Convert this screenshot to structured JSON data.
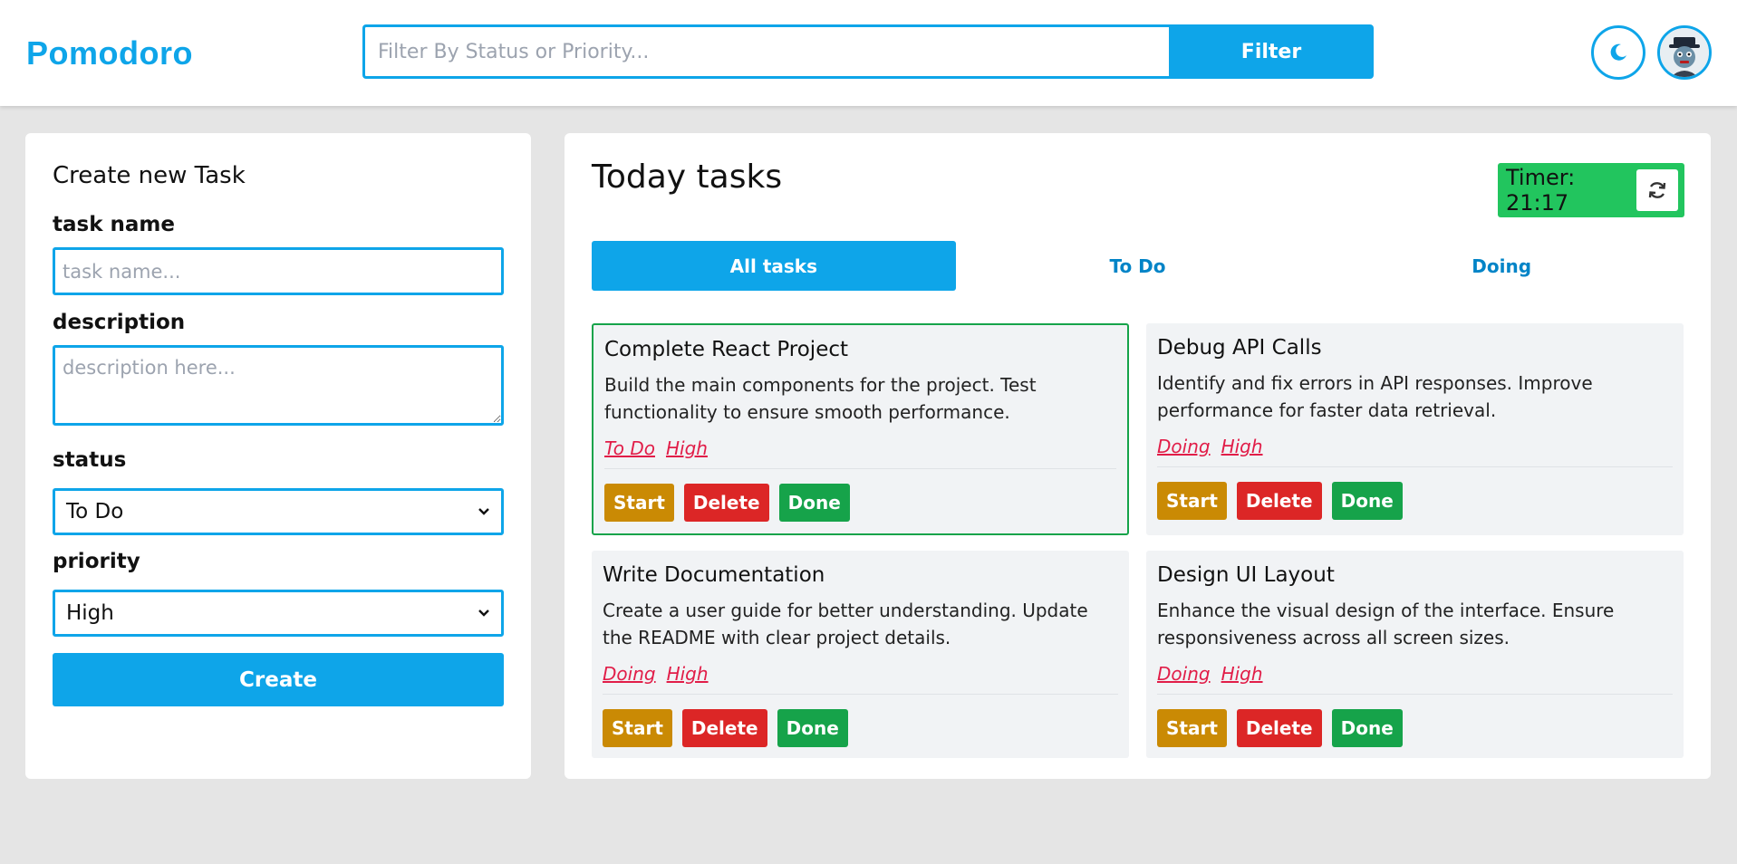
{
  "header": {
    "logo": "Pomodoro",
    "search_placeholder": "Filter By Status or Priority...",
    "filter_label": "Filter",
    "theme_icon": "moon-icon",
    "avatar_icon": "avatar-icon"
  },
  "create_form": {
    "title": "Create new Task",
    "name_label": "task name",
    "name_placeholder": "task name...",
    "description_label": "description",
    "description_placeholder": "description here...",
    "status_label": "status",
    "status_value": "To Do",
    "priority_label": "priority",
    "priority_value": "High",
    "create_label": "Create"
  },
  "main": {
    "title": "Today tasks",
    "timer": "Timer: 21:17",
    "reset_icon": "refresh-icon",
    "tabs": [
      {
        "label": "All tasks",
        "active": true
      },
      {
        "label": "To Do",
        "active": false
      },
      {
        "label": "Doing",
        "active": false
      }
    ],
    "tasks": [
      {
        "title": "Complete React Project",
        "description": "Build the main components for the project. Test functionality to ensure smooth performance.",
        "status": "To Do",
        "priority": "High",
        "start": "Start",
        "delete": "Delete",
        "done": "Done"
      },
      {
        "title": "Debug API Calls",
        "description": "Identify and fix errors in API responses. Improve performance for faster data retrieval.",
        "status": "Doing",
        "priority": "High",
        "start": "Start",
        "delete": "Delete",
        "done": "Done"
      },
      {
        "title": "Write Documentation",
        "description": "Create a user guide for better understanding. Update the README with clear project details.",
        "status": "Doing",
        "priority": "High",
        "start": "Start",
        "delete": "Delete",
        "done": "Done"
      },
      {
        "title": "Design UI Layout",
        "description": "Enhance the visual design of the interface. Ensure responsiveness across all screen sizes.",
        "status": "Doing",
        "priority": "High",
        "start": "Start",
        "delete": "Delete",
        "done": "Done"
      }
    ]
  },
  "colors": {
    "accent": "#0ea5e9",
    "timer": "#22c55e",
    "start": "#ca8a04",
    "delete": "#dc2626",
    "done": "#16a34a",
    "tag": "#e11d48"
  }
}
